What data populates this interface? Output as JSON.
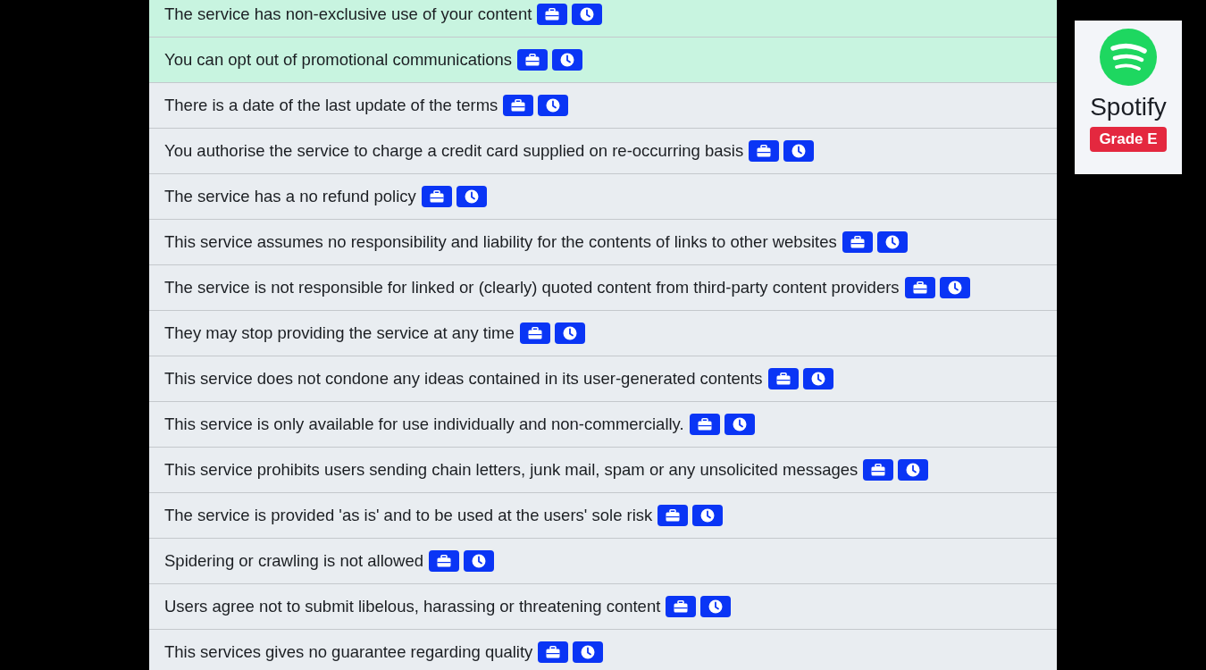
{
  "points": [
    {
      "text": "The service has non-exclusive use of your content",
      "kind": "good"
    },
    {
      "text": "You can opt out of promotional communications",
      "kind": "good"
    },
    {
      "text": "There is a date of the last update of the terms",
      "kind": "neutral"
    },
    {
      "text": "You authorise the service to charge a credit card supplied on re-occurring basis",
      "kind": "neutral"
    },
    {
      "text": "The service has a no refund policy",
      "kind": "neutral"
    },
    {
      "text": "This service assumes no responsibility and liability for the contents of links to other websites",
      "kind": "neutral"
    },
    {
      "text": "The service is not responsible for linked or (clearly) quoted content from third-party content providers",
      "kind": "neutral"
    },
    {
      "text": "They may stop providing the service at any time",
      "kind": "neutral"
    },
    {
      "text": "This service does not condone any ideas contained in its user-generated contents",
      "kind": "neutral"
    },
    {
      "text": "This service is only available for use individually and non-commercially.",
      "kind": "neutral"
    },
    {
      "text": "This service prohibits users sending chain letters, junk mail, spam or any unsolicited messages",
      "kind": "neutral"
    },
    {
      "text": "The service is provided 'as is' and to be used at the users' sole risk",
      "kind": "neutral"
    },
    {
      "text": "Spidering or crawling is not allowed",
      "kind": "neutral"
    },
    {
      "text": "Users agree not to submit libelous, harassing or threatening content",
      "kind": "neutral"
    },
    {
      "text": "This services gives no guarantee regarding quality",
      "kind": "neutral"
    }
  ],
  "service_card": {
    "name": "Spotify",
    "grade": "Grade E"
  }
}
